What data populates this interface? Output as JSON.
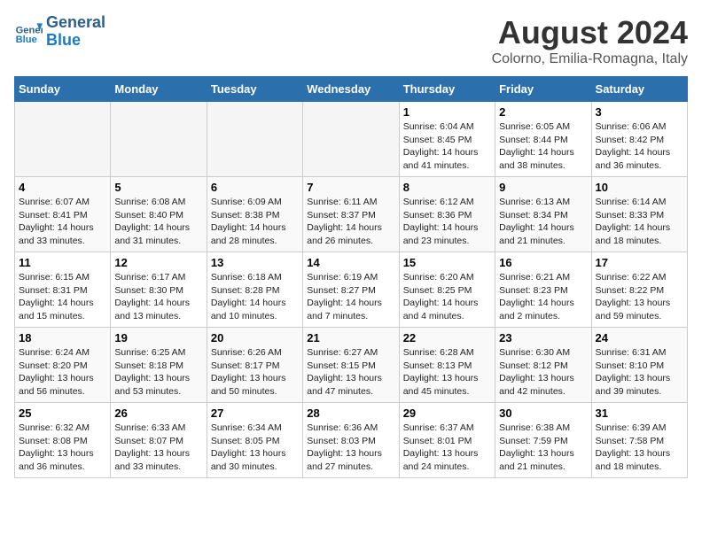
{
  "header": {
    "logo_line1": "General",
    "logo_line2": "Blue",
    "month": "August 2024",
    "location": "Colorno, Emilia-Romagna, Italy"
  },
  "weekdays": [
    "Sunday",
    "Monday",
    "Tuesday",
    "Wednesday",
    "Thursday",
    "Friday",
    "Saturday"
  ],
  "weeks": [
    [
      {
        "day": "",
        "info": ""
      },
      {
        "day": "",
        "info": ""
      },
      {
        "day": "",
        "info": ""
      },
      {
        "day": "",
        "info": ""
      },
      {
        "day": "1",
        "info": "Sunrise: 6:04 AM\nSunset: 8:45 PM\nDaylight: 14 hours and 41 minutes."
      },
      {
        "day": "2",
        "info": "Sunrise: 6:05 AM\nSunset: 8:44 PM\nDaylight: 14 hours and 38 minutes."
      },
      {
        "day": "3",
        "info": "Sunrise: 6:06 AM\nSunset: 8:42 PM\nDaylight: 14 hours and 36 minutes."
      }
    ],
    [
      {
        "day": "4",
        "info": "Sunrise: 6:07 AM\nSunset: 8:41 PM\nDaylight: 14 hours and 33 minutes."
      },
      {
        "day": "5",
        "info": "Sunrise: 6:08 AM\nSunset: 8:40 PM\nDaylight: 14 hours and 31 minutes."
      },
      {
        "day": "6",
        "info": "Sunrise: 6:09 AM\nSunset: 8:38 PM\nDaylight: 14 hours and 28 minutes."
      },
      {
        "day": "7",
        "info": "Sunrise: 6:11 AM\nSunset: 8:37 PM\nDaylight: 14 hours and 26 minutes."
      },
      {
        "day": "8",
        "info": "Sunrise: 6:12 AM\nSunset: 8:36 PM\nDaylight: 14 hours and 23 minutes."
      },
      {
        "day": "9",
        "info": "Sunrise: 6:13 AM\nSunset: 8:34 PM\nDaylight: 14 hours and 21 minutes."
      },
      {
        "day": "10",
        "info": "Sunrise: 6:14 AM\nSunset: 8:33 PM\nDaylight: 14 hours and 18 minutes."
      }
    ],
    [
      {
        "day": "11",
        "info": "Sunrise: 6:15 AM\nSunset: 8:31 PM\nDaylight: 14 hours and 15 minutes."
      },
      {
        "day": "12",
        "info": "Sunrise: 6:17 AM\nSunset: 8:30 PM\nDaylight: 14 hours and 13 minutes."
      },
      {
        "day": "13",
        "info": "Sunrise: 6:18 AM\nSunset: 8:28 PM\nDaylight: 14 hours and 10 minutes."
      },
      {
        "day": "14",
        "info": "Sunrise: 6:19 AM\nSunset: 8:27 PM\nDaylight: 14 hours and 7 minutes."
      },
      {
        "day": "15",
        "info": "Sunrise: 6:20 AM\nSunset: 8:25 PM\nDaylight: 14 hours and 4 minutes."
      },
      {
        "day": "16",
        "info": "Sunrise: 6:21 AM\nSunset: 8:23 PM\nDaylight: 14 hours and 2 minutes."
      },
      {
        "day": "17",
        "info": "Sunrise: 6:22 AM\nSunset: 8:22 PM\nDaylight: 13 hours and 59 minutes."
      }
    ],
    [
      {
        "day": "18",
        "info": "Sunrise: 6:24 AM\nSunset: 8:20 PM\nDaylight: 13 hours and 56 minutes."
      },
      {
        "day": "19",
        "info": "Sunrise: 6:25 AM\nSunset: 8:18 PM\nDaylight: 13 hours and 53 minutes."
      },
      {
        "day": "20",
        "info": "Sunrise: 6:26 AM\nSunset: 8:17 PM\nDaylight: 13 hours and 50 minutes."
      },
      {
        "day": "21",
        "info": "Sunrise: 6:27 AM\nSunset: 8:15 PM\nDaylight: 13 hours and 47 minutes."
      },
      {
        "day": "22",
        "info": "Sunrise: 6:28 AM\nSunset: 8:13 PM\nDaylight: 13 hours and 45 minutes."
      },
      {
        "day": "23",
        "info": "Sunrise: 6:30 AM\nSunset: 8:12 PM\nDaylight: 13 hours and 42 minutes."
      },
      {
        "day": "24",
        "info": "Sunrise: 6:31 AM\nSunset: 8:10 PM\nDaylight: 13 hours and 39 minutes."
      }
    ],
    [
      {
        "day": "25",
        "info": "Sunrise: 6:32 AM\nSunset: 8:08 PM\nDaylight: 13 hours and 36 minutes."
      },
      {
        "day": "26",
        "info": "Sunrise: 6:33 AM\nSunset: 8:07 PM\nDaylight: 13 hours and 33 minutes."
      },
      {
        "day": "27",
        "info": "Sunrise: 6:34 AM\nSunset: 8:05 PM\nDaylight: 13 hours and 30 minutes."
      },
      {
        "day": "28",
        "info": "Sunrise: 6:36 AM\nSunset: 8:03 PM\nDaylight: 13 hours and 27 minutes."
      },
      {
        "day": "29",
        "info": "Sunrise: 6:37 AM\nSunset: 8:01 PM\nDaylight: 13 hours and 24 minutes."
      },
      {
        "day": "30",
        "info": "Sunrise: 6:38 AM\nSunset: 7:59 PM\nDaylight: 13 hours and 21 minutes."
      },
      {
        "day": "31",
        "info": "Sunrise: 6:39 AM\nSunset: 7:58 PM\nDaylight: 13 hours and 18 minutes."
      }
    ]
  ]
}
